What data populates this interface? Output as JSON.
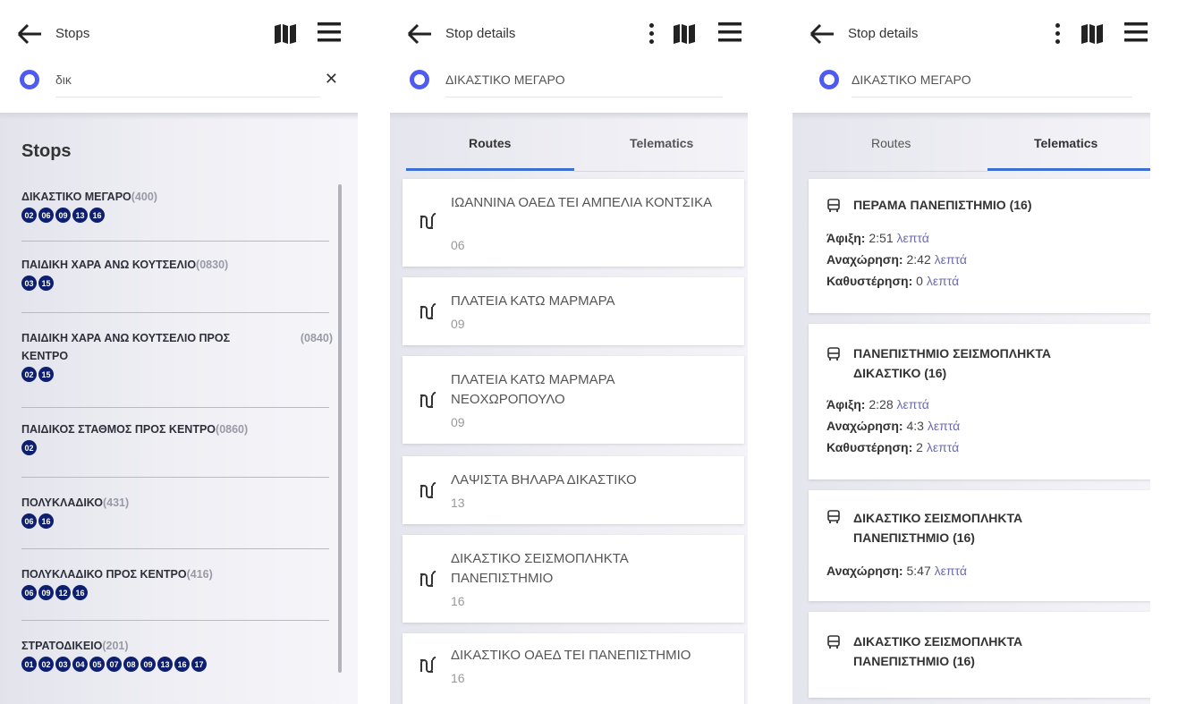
{
  "colors": {
    "accent": "#4d5bf0",
    "badge": "#0d1f6e",
    "tab_active": "#3b6fd4"
  },
  "panel1": {
    "title": "Stops",
    "search_value": "δικ",
    "list_title": "Stops",
    "stops": [
      {
        "name": "ΔΙΚΑΣΤΙΚΟ ΜΕΓΑΡΟ",
        "code": "(400)",
        "lines": [
          "02",
          "06",
          "09",
          "13",
          "16"
        ]
      },
      {
        "name": "ΠΑΙΔΙΚΗ ΧΑΡΑ ΑΝΩ ΚΟΥΤΣΕΛΙΟ",
        "code": "(0830)",
        "lines": [
          "03",
          "15"
        ]
      },
      {
        "name": "ΠΑΙΔΙΚΗ ΧΑΡΑ ΑΝΩ ΚΟΥΤΣΕΛΙΟ ΠΡΟΣ ΚΕΝΤΡΟ",
        "code": "(0840)",
        "lines": [
          "02",
          "15"
        ]
      },
      {
        "name": "ΠΑΙΔΙΚΟΣ ΣΤΑΘΜΟΣ ΠΡΟΣ ΚΕΝΤΡΟ",
        "code": "(0860)",
        "lines": [
          "02"
        ]
      },
      {
        "name": "ΠΟΛΥΚΛΑΔΙΚΟ",
        "code": "(431)",
        "lines": [
          "06",
          "16"
        ]
      },
      {
        "name": "ΠΟΛΥΚΛΑΔΙΚΟ ΠΡΟΣ ΚΕΝΤΡΟ",
        "code": "(416)",
        "lines": [
          "06",
          "09",
          "12",
          "16"
        ]
      },
      {
        "name": "ΣΤΡΑΤΟΔΙΚΕΙΟ",
        "code": "(201)",
        "lines": [
          "01",
          "02",
          "03",
          "04",
          "05",
          "07",
          "08",
          "09",
          "13",
          "16",
          "17"
        ]
      }
    ]
  },
  "panel2": {
    "title": "Stop details",
    "stop_name": "ΔΙΚΑΣΤΙΚΟ ΜΕΓΑΡΟ",
    "tabs": [
      "Routes",
      "Telematics"
    ],
    "routes": [
      {
        "name": "ΙΩΑΝΝΙΝΑ ΟΑΕΔ ΤΕΙ ΑΜΠΕΛΙΑ ΚΟΝΤΣΙΚΑ",
        "code": "06"
      },
      {
        "name": "ΠΛΑΤΕΙΑ ΚΑΤΩ ΜΑΡΜΑΡΑ",
        "code": "09"
      },
      {
        "name": "ΠΛΑΤΕΙΑ ΚΑΤΩ ΜΑΡΜΑΡΑ ΝΕΟΧΩΡΟΠΟΥΛΟ",
        "code": "09"
      },
      {
        "name": "ΛΑΨΙΣΤΑ ΒΗΛΑΡΑ ΔΙΚΑΣΤΙΚΟ",
        "code": "13"
      },
      {
        "name": "ΔΙΚΑΣΤΙΚΟ ΣΕΙΣΜΟΠΛΗΚΤΑ ΠΑΝΕΠΙΣΤΗΜΙΟ",
        "code": "16"
      },
      {
        "name": "ΔΙΚΑΣΤΙΚΟ ΟΑΕΔ ΤΕΙ ΠΑΝΕΠΙΣΤΗΜΙΟ",
        "code": "16"
      }
    ]
  },
  "panel3": {
    "title": "Stop details",
    "stop_name": "ΔΙΚΑΣΤΙΚΟ ΜΕΓΑΡΟ",
    "tabs": [
      "Routes",
      "Telematics"
    ],
    "labels": {
      "arrival": "Άφιξη:",
      "departure": "Αναχώρηση:",
      "delay": "Καθυστέρηση:",
      "unit": "λεπτά"
    },
    "cards": [
      {
        "title": "ΠΕΡΑΜΑ ΠΑΝΕΠΙΣΤΗΜΙΟ (16)",
        "arrival": "2:51",
        "departure": "2:42",
        "delay": "0"
      },
      {
        "title": "ΠΑΝΕΠΙΣΤΗΜΙΟ ΣΕΙΣΜΟΠΛΗΚΤΑ ΔΙΚΑΣΤΙΚΟ (16)",
        "arrival": "2:28",
        "departure": "4:3",
        "delay": "2"
      },
      {
        "title": "ΔΙΚΑΣΤΙΚΟ ΣΕΙΣΜΟΠΛΗΚΤΑ ΠΑΝΕΠΙΣΤΗΜΙΟ (16)",
        "departure": "5:47"
      },
      {
        "title": "ΔΙΚΑΣΤΙΚΟ ΣΕΙΣΜΟΠΛΗΚΤΑ ΠΑΝΕΠΙΣΤΗΜΙΟ (16)"
      }
    ]
  }
}
